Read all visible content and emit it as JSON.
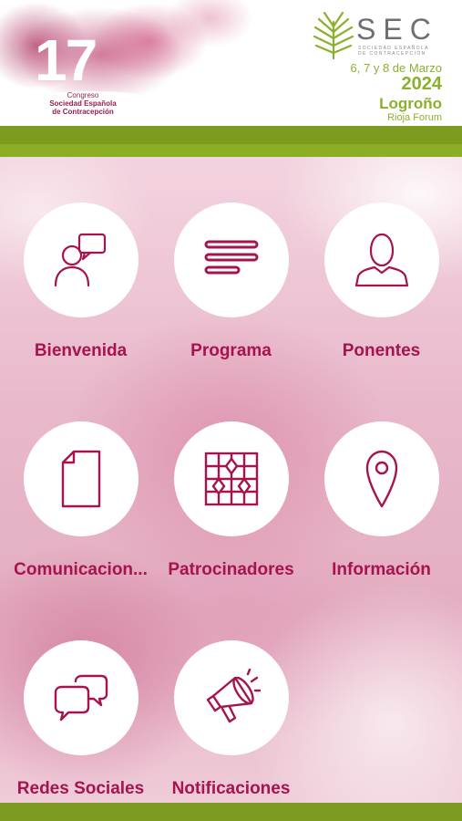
{
  "header": {
    "congress_number": "17",
    "congress_lines": [
      "Congreso",
      "Sociedad Española",
      "de Contracepción"
    ],
    "brand_name": "SEC",
    "brand_subtitle": [
      "SOCIEDAD ESPAÑOLA",
      "DE CONTRACEPCIÓN"
    ],
    "event_dates": "6, 7 y 8 de Marzo",
    "event_year": "2024",
    "event_city": "Logroño",
    "event_venue": "Rioja Forum"
  },
  "colors": {
    "accent": "#a7134e",
    "green": "#7d9b1f",
    "green_light": "#8bb02c",
    "tile_bg": "#ffffff"
  },
  "menu": {
    "items": [
      {
        "label": "Bienvenida",
        "icon": "welcome-speaker-icon"
      },
      {
        "label": "Programa",
        "icon": "program-lines-icon"
      },
      {
        "label": "Ponentes",
        "icon": "speaker-person-icon"
      },
      {
        "label": "Comunicacion...",
        "icon": "document-icon"
      },
      {
        "label": "Patrocinadores",
        "icon": "sponsors-grid-icon"
      },
      {
        "label": "Información",
        "icon": "map-pin-icon"
      },
      {
        "label": "Redes Sociales",
        "icon": "chat-bubbles-icon"
      },
      {
        "label": "Notificaciones",
        "icon": "megaphone-icon"
      }
    ]
  }
}
